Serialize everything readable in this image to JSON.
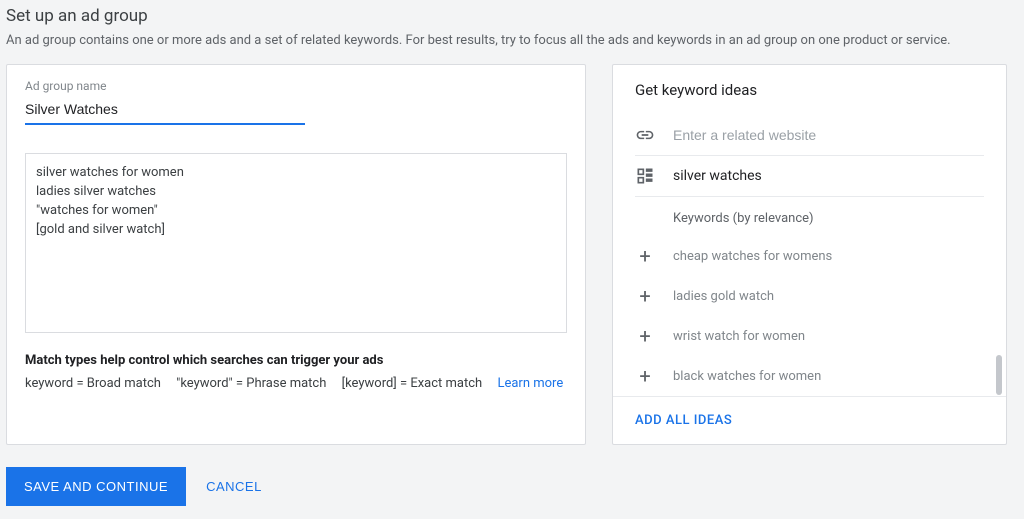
{
  "header": {
    "title": "Set up an ad group",
    "subtitle": "An ad group contains one or more ads and a set of related keywords. For best results, try to focus all the ads and keywords in an ad group on one product or service."
  },
  "adgroup": {
    "name_label": "Ad group name",
    "name_value": "Silver Watches",
    "keywords_value": "silver watches for women\nladies silver watches\n\"watches for women\"\n[gold and silver watch]",
    "match_heading": "Match types help control which searches can trigger your ads",
    "match_broad": "keyword = Broad match",
    "match_phrase": "\"keyword\" = Phrase match",
    "match_exact": "[keyword] = Exact match",
    "learn_more": "Learn more"
  },
  "ideas": {
    "title": "Get keyword ideas",
    "related_site_placeholder": "Enter a related website",
    "query_seed": "silver watches",
    "relevance_header": "Keywords (by relevance)",
    "suggestions": [
      "cheap watches for womens",
      "ladies gold watch",
      "wrist watch for women",
      "black watches for women"
    ],
    "add_all": "ADD ALL IDEAS"
  },
  "footer": {
    "save": "SAVE AND CONTINUE",
    "cancel": "CANCEL"
  }
}
